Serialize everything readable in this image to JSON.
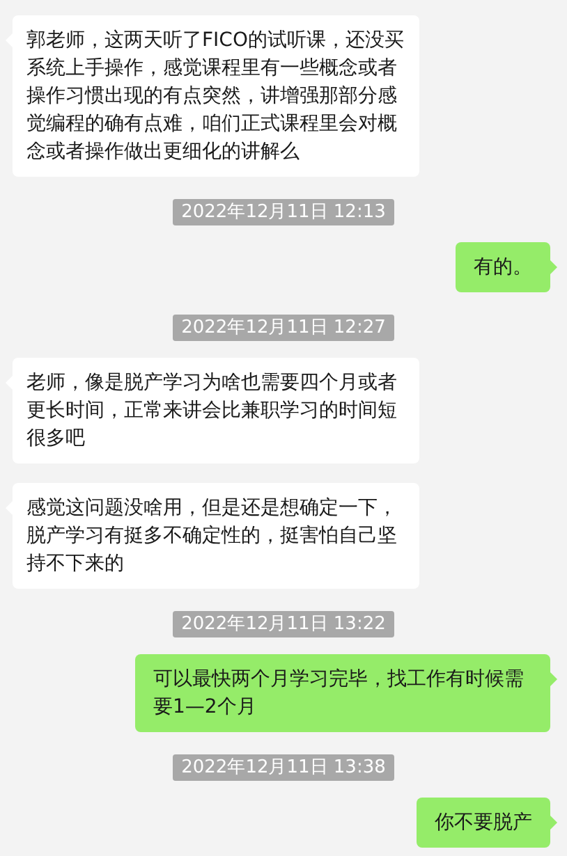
{
  "messages": [
    {
      "kind": "received",
      "text": "郭老师，这两天听了FICO的试听课，还没买系统上手操作，感觉课程里有一些概念或者操作习惯出现的有点突然，讲增强那部分感觉编程的确有点难，咱们正式课程里会对概念或者操作做出更细化的讲解么"
    },
    {
      "kind": "timestamp",
      "text": "2022年12月11日 12:13"
    },
    {
      "kind": "sent",
      "text": "有的。"
    },
    {
      "kind": "timestamp",
      "text": "2022年12月11日 12:27"
    },
    {
      "kind": "received",
      "text": "老师，像是脱产学习为啥也需要四个月或者更长时间，正常来讲会比兼职学习的时间短很多吧"
    },
    {
      "kind": "received",
      "text": "感觉这问题没啥用，但是还是想确定一下，脱产学习有挺多不确定性的，挺害怕自己坚持不下来的"
    },
    {
      "kind": "timestamp",
      "text": "2022年12月11日 13:22"
    },
    {
      "kind": "sent",
      "text": "可以最快两个月学习完毕，找工作有时候需要1—2个月"
    },
    {
      "kind": "timestamp",
      "text": "2022年12月11日 13:38"
    },
    {
      "kind": "sent",
      "text": "你不要脱产"
    }
  ]
}
